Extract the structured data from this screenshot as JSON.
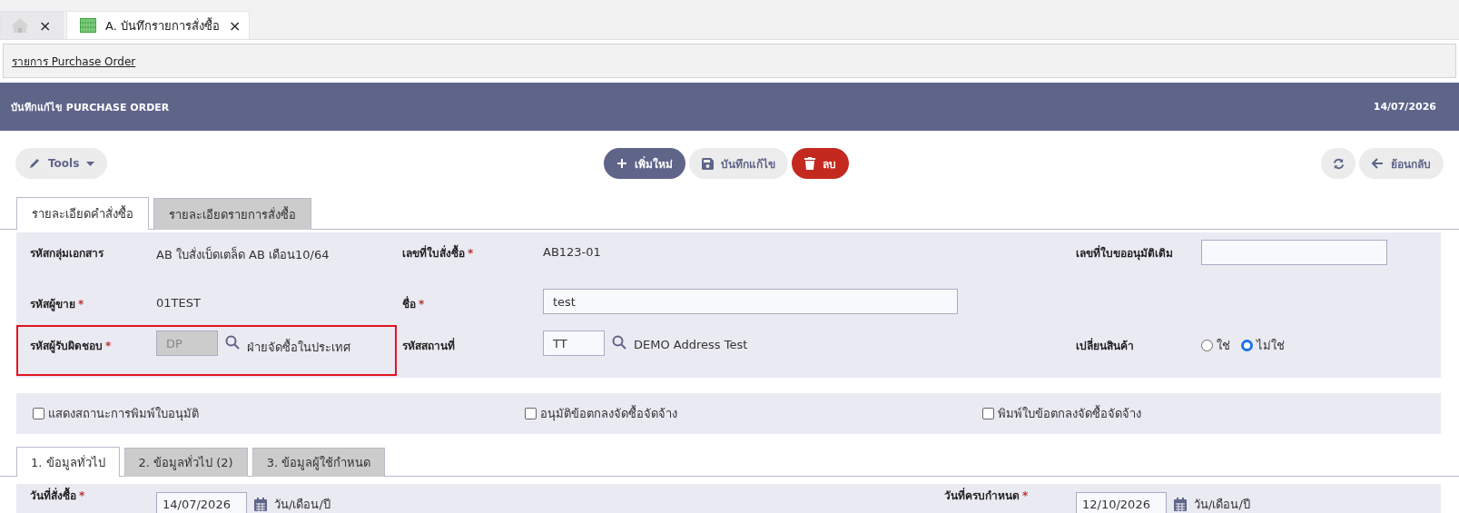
{
  "window_tabs": [
    {
      "kind": "home",
      "close": "×",
      "selected": false
    },
    {
      "kind": "sheet",
      "label": "A. บันทึกรายการสั่งซื้อ",
      "close": "×",
      "selected": true
    }
  ],
  "breadcrumb": "รายการ Purchase Order",
  "header": {
    "title": "บันทึกแก้ไข PURCHASE ORDER",
    "date": "14/07/2026"
  },
  "toolbar": {
    "tools": "Tools",
    "actions": [
      {
        "kind": "add",
        "label": "เพิ่มใหม่"
      },
      {
        "kind": "save",
        "label": "บันทึกแก้ไข"
      },
      {
        "kind": "delete",
        "label": "ลบ"
      }
    ],
    "back": "ย้อนกลับ"
  },
  "tabs": [
    {
      "label": "รายละเอียดคำสั่งซื้อ",
      "selected": true
    },
    {
      "label": "รายละเอียดรายการสั่งซื้อ",
      "selected": false
    }
  ],
  "fields": [
    {
      "kind": "text",
      "label": "รหัสกลุ่มเอกสาร",
      "value": "AB ใบสั่งเบ็ดเตล็ด AB เดือน10/64"
    },
    {
      "kind": "text",
      "label": "เลขที่ใบสั่งซื้อ",
      "required_mark": "*",
      "value": "AB123-01"
    },
    {
      "kind": "input",
      "label": "เลขที่ใบขออนุมัติเดิม"
    },
    {
      "kind": "text",
      "label": "รหัสผู้ขาย",
      "required_mark": "*",
      "value": "01TEST"
    },
    {
      "kind": "input",
      "label": "ชื่อ",
      "required_mark": "*",
      "value": "test"
    },
    {
      "kind": "empty"
    },
    {
      "kind": "lookup",
      "label": "รหัสผู้รับผิดชอบ",
      "required_mark": "*",
      "value": "DP",
      "disabled": true,
      "description": "ฝ่ายจัดซื้อในประเทศ",
      "highlighted": true
    },
    {
      "kind": "lookup",
      "label": "รหัสสถานที่",
      "value": "TT",
      "disabled": false,
      "description": "DEMO Address Test"
    },
    {
      "kind": "radio",
      "label": "เปลี่ยนสินค้า",
      "options": [
        {
          "label": "ใช่",
          "selected": false
        },
        {
          "label": "ไม่ใช่",
          "selected": true
        }
      ]
    }
  ],
  "checkboxes": [
    {
      "label": "แสดงสถานะการพิมพ์ใบอนุมัติ",
      "checked": false
    },
    {
      "label": "อนุมัติข้อตกลงจัดซื้อจัดจ้าง",
      "checked": false
    },
    {
      "label": "พิมพ์ใบข้อตกลงจัดซื้อจัดจ้าง",
      "checked": false
    }
  ],
  "sub_tabs": [
    {
      "label": "1. ข้อมูลทั่วไป",
      "selected": true
    },
    {
      "label": "2. ข้อมูลทั่วไป (2)",
      "selected": false
    },
    {
      "label": "3. ข้อมูลผู้ใช้กำหนด",
      "selected": false
    }
  ],
  "dates": [
    {
      "label": "วันที่สั่งซื้อ",
      "required_mark": "*",
      "value": "14/07/2026",
      "hint": "วัน/เดือน/ปี"
    },
    {
      "label": "วันที่ครบกำหนด",
      "required_mark": "*",
      "value": "12/10/2026",
      "hint": "วัน/เดือน/ปี"
    }
  ]
}
